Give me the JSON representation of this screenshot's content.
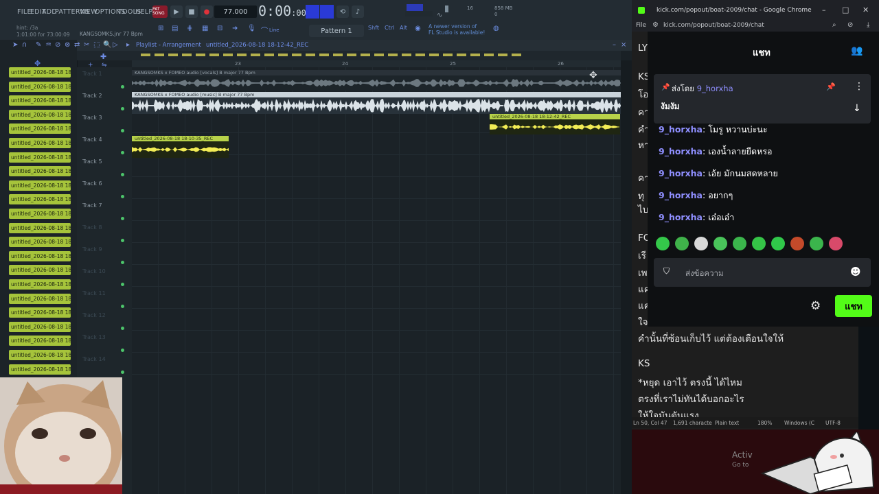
{
  "fl": {
    "menu": [
      "FILE",
      "EDIT",
      "ADD",
      "PATTERNS",
      "VIEW",
      "OPTIONS",
      "TOOLS",
      "HELP"
    ],
    "pat_song": "PAT SONG",
    "tempo": "77.000",
    "time": "0:00",
    "time_small": ":00",
    "hint_line1": "hint: /3a",
    "hint_line2": "1:01:00 for 73:00:09",
    "song_file": "KANGSOMKS.jnr 77 Bpm",
    "cpu": "858 MB",
    "cpu2": "0",
    "line_mode": "Line",
    "pattern": "Pattern 1",
    "update_note_1": "A newer version of",
    "update_note_2": "FL Studio is available!",
    "playlist_title": "Playlist - Arrangement",
    "playlist_file": "untitled_2026-08-18 18-12-42_REC",
    "bar_numbers": [
      "23",
      "24",
      "25",
      "26"
    ],
    "browser_item": "untitled_2026-08-18 18-",
    "tracks": [
      "Track 1",
      "Track 2",
      "Track 3",
      "Track 4",
      "Track 5",
      "Track 6",
      "Track 7",
      "Track 8",
      "Track 9",
      "Track 10",
      "Track 11",
      "Track 12",
      "Track 13",
      "Track 14"
    ],
    "clips": {
      "vocals": "KANGSOMKS x FOMEO audio [vocals] B major 77 Bpm",
      "music": "KANGSOMKS x FOMEO audio [music] B major 77 Bpm",
      "rec1": "untitled_2026-08-18 18-12-42_REC",
      "rec2": "untitled_2026-08-18 18-10-35_REC"
    }
  },
  "chrome": {
    "title": "kick.com/popout/boat-2009/chat - Google Chrome",
    "url": "kick.com/popout/boat-2009/chat",
    "behind_tab": "File"
  },
  "chat": {
    "title": "แชท",
    "pinned_by_label": "ส่งโดย",
    "pinned_user": "9_horxha",
    "pinned_message": "งัมงัม",
    "messages": [
      {
        "user": "9_horxha",
        "text": "โมรู หวานบ่ะนะ"
      },
      {
        "user": "9_horxha",
        "text": "เองน้ำลายยืดหรอ"
      },
      {
        "user": "9_horxha",
        "text": "เอ้ย มักนมสดหลาย"
      },
      {
        "user": "9_horxha",
        "text": "อยากๆ"
      },
      {
        "user": "9_horxha",
        "text": "เอ๋อเอ๋า"
      }
    ],
    "input_placeholder": "ส่งข้อความ",
    "send_label": "แชท"
  },
  "notepad": {
    "lines": [
      "LY",
      "KS",
      "โอ",
      "คา",
      "คำ",
      "หา",
      "คา",
      "ทุ",
      "ไบ",
      "FO",
      "เรี",
      "เพ",
      "แค",
      "แค",
      "ใจ",
      "คำนั้นที่ซ้อนเก็บไว้  แต่ต้องเตือนใจให้",
      "KS",
      "*หยุด  เอาไว้  ตรงนี้  ได้ไหม",
      "ตรงที่เราไม่ทันได้บอกอะไร",
      "ให้ใจมันตันแรง"
    ],
    "status_pos": "Ln 50, Col 47",
    "status_chars": "1,691 characte",
    "status_type": "Plain text",
    "status_zoom": "180%",
    "status_eol": "Windows (C",
    "status_enc": "UTF-8"
  },
  "desktop": {
    "activate": "Activ",
    "goto": "Go to"
  }
}
